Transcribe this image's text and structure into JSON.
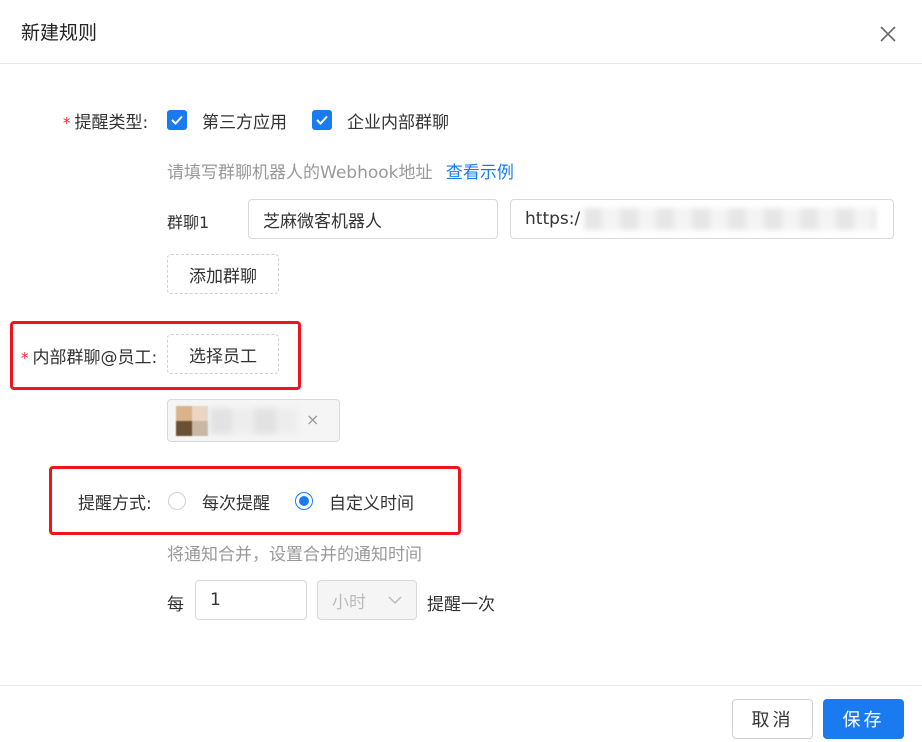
{
  "dialog": {
    "title": "新建规则",
    "close_icon": "close-icon"
  },
  "form": {
    "reminder_type": {
      "label": "提醒类型:",
      "options": [
        {
          "label": "第三方应用",
          "checked": true
        },
        {
          "label": "企业内部群聊",
          "checked": true
        }
      ],
      "hint": "请填写群聊机器人的Webhook地址",
      "hint_link": "查看示例",
      "group": {
        "label": "群聊1",
        "name_value": "芝麻微客机器人",
        "url_value": "https:/"
      },
      "add_group_label": "添加群聊"
    },
    "mention_staff": {
      "label": "内部群聊@员工:",
      "select_label": "选择员工",
      "tag_remove": "×"
    },
    "reminder_mode": {
      "label": "提醒方式:",
      "options": [
        {
          "label": "每次提醒",
          "selected": false
        },
        {
          "label": "自定义时间",
          "selected": true
        }
      ],
      "hint": "将通知合并，设置合并的通知时间",
      "every_label": "每",
      "interval_value": "1",
      "unit": "小时",
      "suffix": "提醒一次"
    }
  },
  "footer": {
    "cancel_label": "取消",
    "save_label": "保存"
  },
  "colors": {
    "primary": "#1a7bf0",
    "required": "#f5222d",
    "highlight_box": "#f0141e"
  }
}
